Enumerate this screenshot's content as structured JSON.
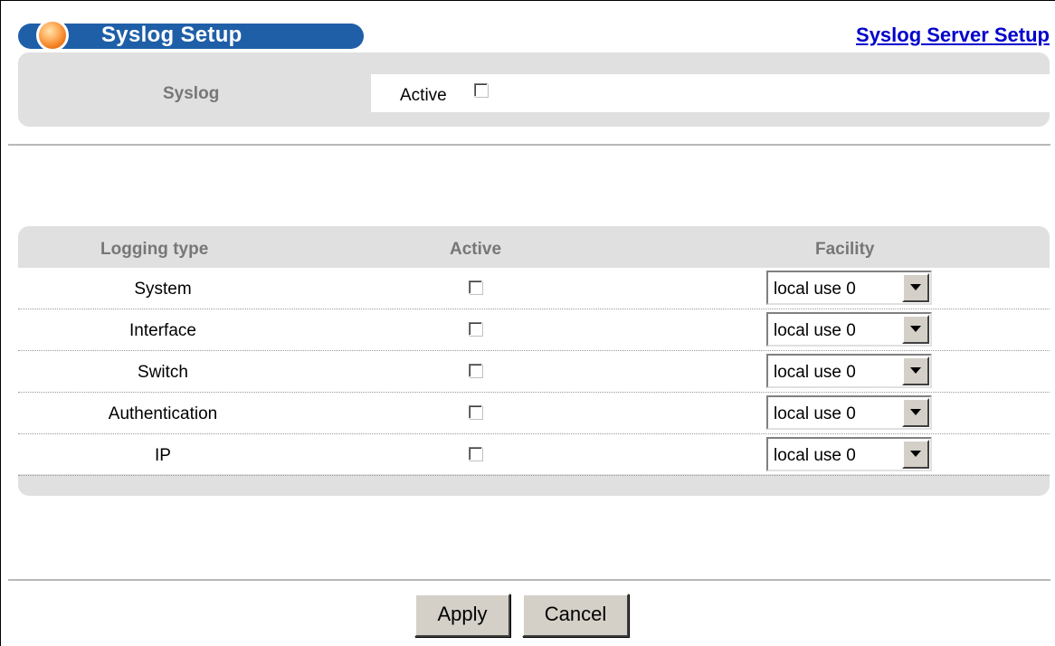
{
  "header": {
    "title": "Syslog Setup",
    "server_link": "Syslog Server Setup"
  },
  "syslog": {
    "label": "Syslog",
    "active_label": "Active",
    "active_checked": false
  },
  "logging_table": {
    "columns": [
      "Logging type",
      "Active",
      "Facility"
    ],
    "rows": [
      {
        "type": "System",
        "active": false,
        "facility": "local use 0"
      },
      {
        "type": "Interface",
        "active": false,
        "facility": "local use 0"
      },
      {
        "type": "Switch",
        "active": false,
        "facility": "local use 0"
      },
      {
        "type": "Authentication",
        "active": false,
        "facility": "local use 0"
      },
      {
        "type": "IP",
        "active": false,
        "facility": "local use 0"
      }
    ]
  },
  "buttons": {
    "apply": "Apply",
    "cancel": "Cancel"
  },
  "colors": {
    "title_bar": "#1f5fa8",
    "panel_gray": "#e0e0e0",
    "link": "#0000cc"
  },
  "icons": {
    "title_icon": "orange-ball-icon",
    "dropdown_icon": "chevron-down-icon"
  }
}
